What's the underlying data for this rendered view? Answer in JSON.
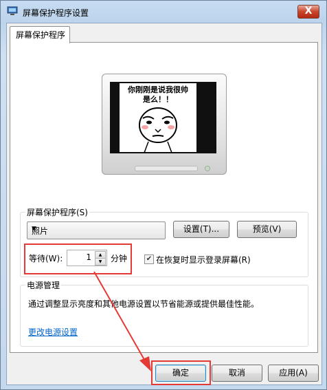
{
  "window": {
    "title": "屏幕保护程序设置",
    "close_label": "X"
  },
  "tab": {
    "label": "屏幕保护程序"
  },
  "preview": {
    "caption_line1": "你刚刚是说我很帅",
    "caption_line2": "是么！！"
  },
  "screensaver": {
    "group_label": "屏幕保护程序(S)",
    "selected": "照片",
    "settings_button": "设置(T)...",
    "preview_button": "预览(V)",
    "wait_label": "等待(W):",
    "wait_value": "1",
    "wait_unit": "分钟",
    "resume_checked": true,
    "resume_label": "在恢复时显示登录屏幕(R)"
  },
  "power": {
    "group_label": "电源管理",
    "description": "通过调整显示亮度和其他电源设置以节省能源或提供最佳性能。",
    "link": "更改电源设置"
  },
  "buttons": {
    "ok": "确定",
    "cancel": "取消",
    "apply": "应用(A)"
  },
  "colors": {
    "annotation": "#e53935",
    "link": "#0066cc"
  }
}
